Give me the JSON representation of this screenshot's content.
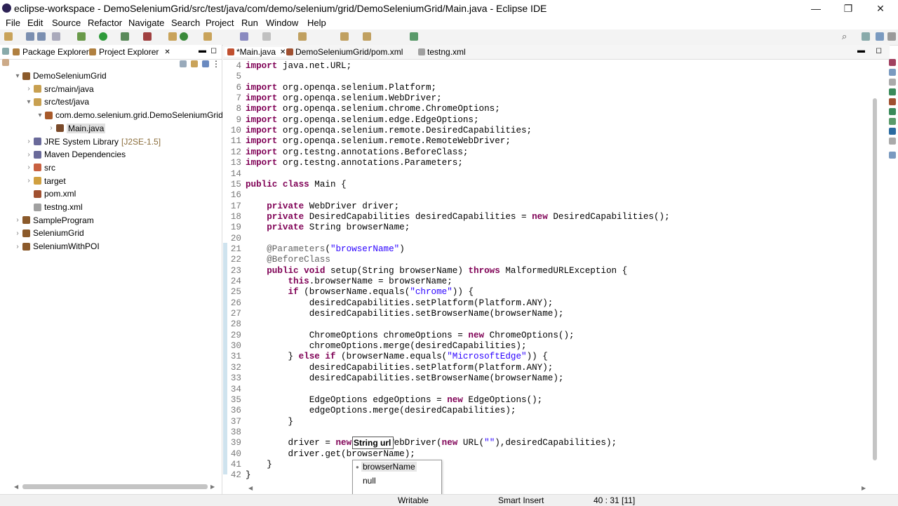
{
  "window": {
    "title": "eclipse-workspace - DemoSeleniumGrid/src/test/java/com/demo/selenium/grid/DemoSeleniumGrid/Main.java - Eclipse IDE",
    "minimize": "—",
    "maximize": "❐",
    "close": "✕"
  },
  "menu": [
    "File",
    "Edit",
    "Source",
    "Refactor",
    "Navigate",
    "Search",
    "Project",
    "Run",
    "Window",
    "Help"
  ],
  "left_panel": {
    "tabs": [
      {
        "label": "Package Explorer"
      },
      {
        "label": "Project Explorer",
        "close": "✕"
      }
    ],
    "tree": [
      {
        "label": "DemoSeleniumGrid",
        "arrow": "▾",
        "icon_color": "#8b5a2b"
      },
      {
        "label": "src/main/java",
        "arrow": "›",
        "icon_color": "#c8a050"
      },
      {
        "label": "src/test/java",
        "arrow": "▾",
        "icon_color": "#c8a050"
      },
      {
        "label": "com.demo.selenium.grid.DemoSeleniumGrid",
        "arrow": "▾",
        "icon_color": "#a85a2a"
      },
      {
        "label": "Main.java",
        "arrow": "›",
        "icon_color": "#7a4a2a"
      },
      {
        "label": "JRE System Library",
        "extra": "[J2SE-1.5]",
        "arrow": "›",
        "icon_color": "#6a6a9a"
      },
      {
        "label": "Maven Dependencies",
        "arrow": "›",
        "icon_color": "#6a6a9a"
      },
      {
        "label": "src",
        "arrow": "›",
        "icon_color": "#c86040"
      },
      {
        "label": "target",
        "arrow": "›",
        "icon_color": "#d0a040"
      },
      {
        "label": "pom.xml",
        "arrow": "",
        "icon_color": "#a05030"
      },
      {
        "label": "testng.xml",
        "arrow": "",
        "icon_color": "#a0a0a0"
      },
      {
        "label": "SampleProgram",
        "arrow": "›",
        "icon_color": "#8b5a2b"
      },
      {
        "label": "SeleniumGrid",
        "arrow": "›",
        "icon_color": "#8b5a2b"
      },
      {
        "label": "SeleniumWithPOI",
        "arrow": "›",
        "icon_color": "#8b5a2b"
      }
    ]
  },
  "editor": {
    "tabs": [
      {
        "label": "*Main.java",
        "close": "✕"
      },
      {
        "label": "DemoSeleniumGrid/pom.xml"
      },
      {
        "label": "testng.xml"
      }
    ],
    "lines": [
      {
        "n": "4",
        "code": "import java.net.URL;"
      },
      {
        "n": "5",
        "code": ""
      },
      {
        "n": "6",
        "code": "import org.openqa.selenium.Platform;"
      },
      {
        "n": "7",
        "code": "import org.openqa.selenium.WebDriver;"
      },
      {
        "n": "8",
        "code": "import org.openqa.selenium.chrome.ChromeOptions;"
      },
      {
        "n": "9",
        "code": "import org.openqa.selenium.edge.EdgeOptions;"
      },
      {
        "n": "10",
        "code": "import org.openqa.selenium.remote.DesiredCapabilities;"
      },
      {
        "n": "11",
        "code": "import org.openqa.selenium.remote.RemoteWebDriver;"
      },
      {
        "n": "12",
        "code": "import org.testng.annotations.BeforeClass;"
      },
      {
        "n": "13",
        "code": "import org.testng.annotations.Parameters;"
      },
      {
        "n": "14",
        "code": ""
      },
      {
        "n": "15",
        "code": "public class Main {"
      },
      {
        "n": "16",
        "code": ""
      },
      {
        "n": "17",
        "code": "    private WebDriver driver;"
      },
      {
        "n": "18",
        "code": "    private DesiredCapabilities desiredCapabilities = new DesiredCapabilities();"
      },
      {
        "n": "19",
        "code": "    private String browserName;"
      },
      {
        "n": "20",
        "code": ""
      },
      {
        "n": "21",
        "code": "    @Parameters(\"browserName\")"
      },
      {
        "n": "22",
        "code": "    @BeforeClass"
      },
      {
        "n": "23",
        "code": "    public void setup(String browserName) throws MalformedURLException {"
      },
      {
        "n": "24",
        "code": "        this.browserName = browserName;"
      },
      {
        "n": "25",
        "code": "        if (browserName.equals(\"chrome\")) {"
      },
      {
        "n": "26",
        "code": "            desiredCapabilities.setPlatform(Platform.ANY);"
      },
      {
        "n": "27",
        "code": "            desiredCapabilities.setBrowserName(browserName);"
      },
      {
        "n": "28",
        "code": ""
      },
      {
        "n": "29",
        "code": "            ChromeOptions chromeOptions = new ChromeOptions();"
      },
      {
        "n": "30",
        "code": "            chromeOptions.merge(desiredCapabilities);"
      },
      {
        "n": "31",
        "code": "        } else if (browserName.equals(\"MicrosoftEdge\")) {"
      },
      {
        "n": "32",
        "code": "            desiredCapabilities.setPlatform(Platform.ANY);"
      },
      {
        "n": "33",
        "code": "            desiredCapabilities.setBrowserName(browserName);"
      },
      {
        "n": "34",
        "code": ""
      },
      {
        "n": "35",
        "code": "            EdgeOptions edgeOptions = new EdgeOptions();"
      },
      {
        "n": "36",
        "code": "            edgeOptions.merge(desiredCapabilities);"
      },
      {
        "n": "37",
        "code": "        }"
      },
      {
        "n": "38",
        "code": ""
      },
      {
        "n": "39",
        "code": "        driver = new RemoteWebDriver(new URL(\"\"),desiredCapabilities);"
      },
      {
        "n": "40",
        "code": "        driver.get(browserName);"
      },
      {
        "n": "41",
        "code": "    }"
      },
      {
        "n": "42",
        "code": "}"
      }
    ],
    "param_hint": "String url",
    "autocomplete": [
      {
        "label": "browserName",
        "selected": true
      },
      {
        "label": "null",
        "selected": false
      }
    ]
  },
  "status": {
    "writable": "Writable",
    "insert_mode": "Smart Insert",
    "position": "40 : 31 [11]"
  },
  "colors": {
    "keyword": "#7f0055",
    "field": "#0000c0",
    "string": "#2a00ff",
    "annotation": "#646464"
  }
}
